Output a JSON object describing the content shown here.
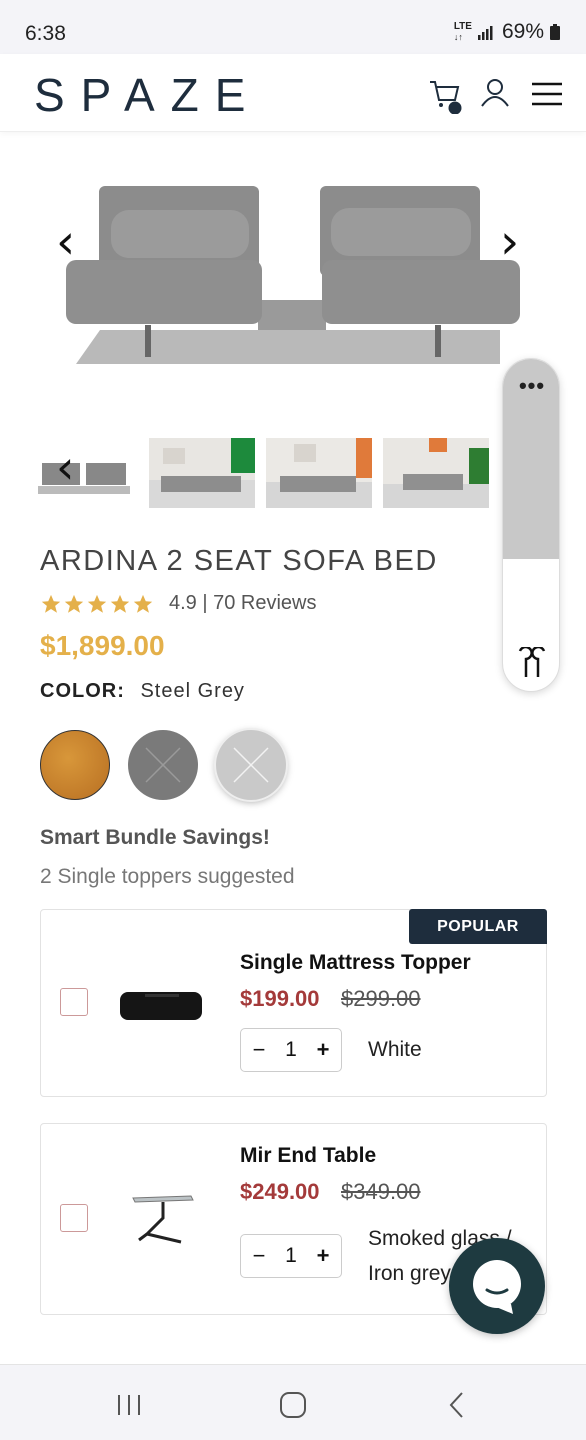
{
  "status_bar": {
    "time": "6:38",
    "network": "LTE",
    "battery": "69%"
  },
  "header": {
    "logo": "SPAZE",
    "icons": [
      "cart-icon",
      "user-icon",
      "menu-icon"
    ]
  },
  "product": {
    "title": "ARDINA 2 SEAT SOFA BED",
    "rating_text": "4.9 | 70 Reviews",
    "stars": 5,
    "price": "$1,899.00",
    "color_label": "COLOR:",
    "color_value": "Steel Grey",
    "swatches": [
      "Orange",
      "Dark Grey",
      "Steel Grey"
    ]
  },
  "bundle": {
    "title": "Smart Bundle Savings!",
    "subtitle": "2 Single toppers suggested",
    "items": [
      {
        "badge": "POPULAR",
        "name": "Single Mattress Topper",
        "sale_price": "$199.00",
        "original_price": "$299.00",
        "qty": "1",
        "variant": "White"
      },
      {
        "name": "Mir End Table",
        "sale_price": "$249.00",
        "original_price": "$349.00",
        "qty": "1",
        "variant_line1": "Smoked glass /",
        "variant_line2": "Iron grey"
      }
    ]
  },
  "stepper": {
    "minus": "−",
    "plus": "+"
  },
  "colors": {
    "navy": "#1e2d3d",
    "gold": "#e4b04a",
    "sale_red": "#a43a3a",
    "chat": "#1e3a40"
  }
}
